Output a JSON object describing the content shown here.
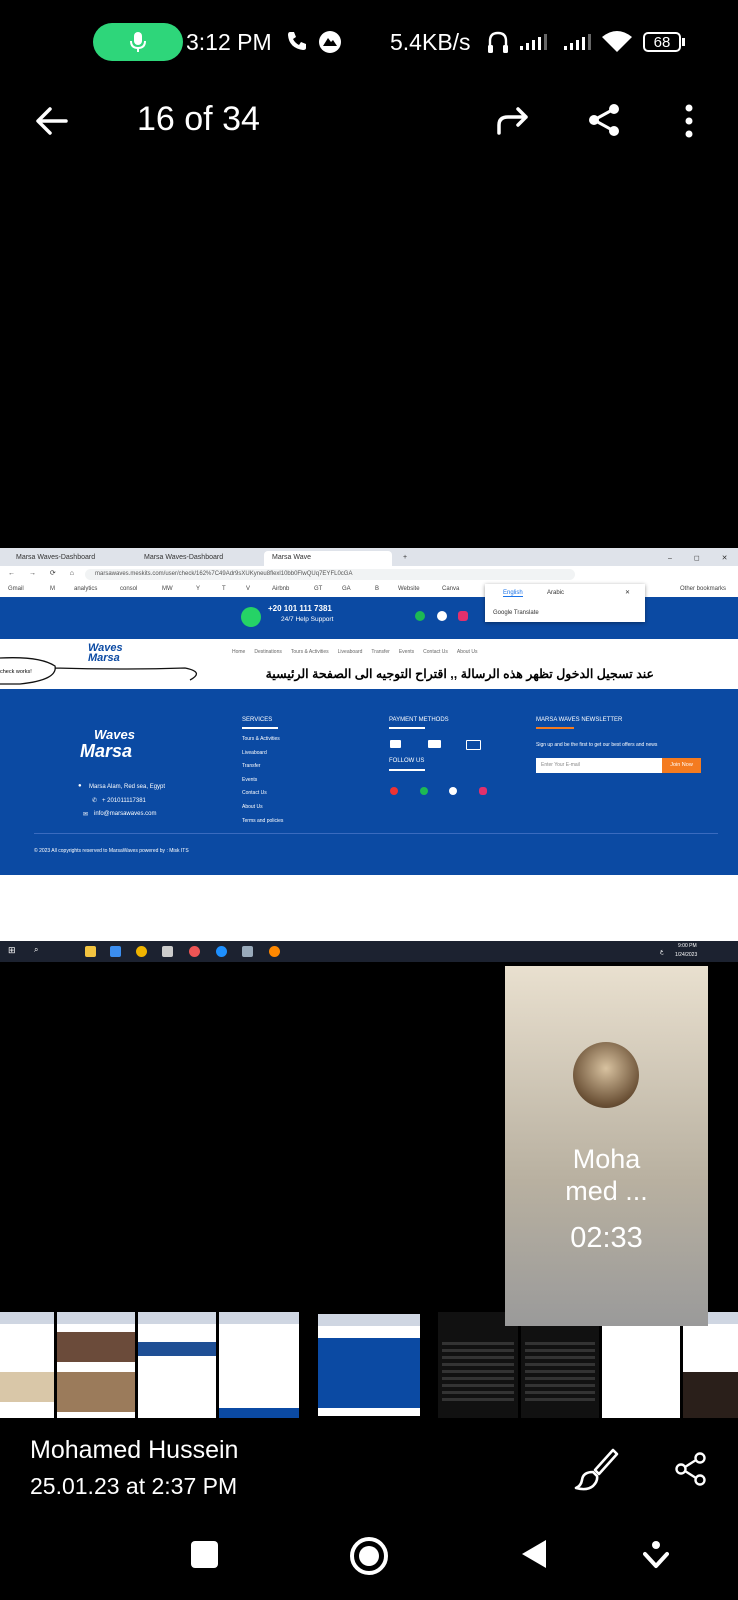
{
  "status_bar": {
    "time": "3:12 PM",
    "network_speed": "5.4KB/s",
    "battery": "68"
  },
  "toolbar": {
    "title": "16 of 34"
  },
  "screenshot": {
    "tabs": [
      "Marsa Waves-Dashboard",
      "Marsa Waves-Dashboard",
      "Marsa Wave"
    ],
    "url": "marsawaves.meskits.com/user/check/162%7C49Adr9sXUKyneu8flexl10bb0FlwQUq7EYFL0cGA",
    "bookmarks": [
      "Gmail",
      "M",
      "analytics",
      "consol",
      "MW",
      "Y",
      "T",
      "V",
      "Airbnb",
      "GT",
      "GA",
      "B",
      "Website",
      "Canva",
      "Other bookmarks"
    ],
    "translate": {
      "lang1": "English",
      "lang2": "Arabic",
      "brand": "Google Translate"
    },
    "phone": "+20 101 111 7381",
    "support": "24/7 Help Support",
    "nav": [
      "Home",
      "Destinations",
      "Tours & Activities",
      "Liveaboard",
      "Transfer",
      "Events",
      "Contact Us",
      "About Us"
    ],
    "logo_line1": "Waves",
    "logo_line2": "Marsa",
    "annotation_note": "check works!",
    "arabic_message": "عند تسجيل الدخول تظهر هذه الرسالة ,, اقتراح التوجيه الى الصفحة الرئيسية",
    "footer": {
      "address": "Marsa Alam, Red sea, Egypt",
      "phone": "+ 201011117381",
      "email": "info@marsawaves.com",
      "services_title": "SERVICES",
      "services": [
        "Tours & Activities",
        "Liveaboard",
        "Transfer",
        "Events",
        "Contact Us",
        "About Us",
        "Terms and policies"
      ],
      "payment_title": "PAYMENT METHODS",
      "follow_title": "FOLLOW US",
      "newsletter_title": "MARSA WAVES NEWSLETTER",
      "newsletter_text": "Sign up and be the first to get our best offers and news",
      "email_placeholder": "Enter Your E-mail",
      "join_label": "Join Now",
      "copyright": "© 2023 All copyrights reserved to MarsaWaves powered by : Misk ITS"
    },
    "taskbar_time": "9:00 PM",
    "taskbar_date": "1/24/2023",
    "taskbar_lang": "ع"
  },
  "call": {
    "name_line1": "Moha",
    "name_line2": "med ...",
    "duration": "02:33"
  },
  "sender": {
    "name": "Mohamed Hussein",
    "date": "25.01.23 at 2:37 PM"
  },
  "colors": {
    "accent_green": "#2ed67a",
    "site_blue": "#0b4aa3",
    "join_orange": "#f47b20"
  }
}
